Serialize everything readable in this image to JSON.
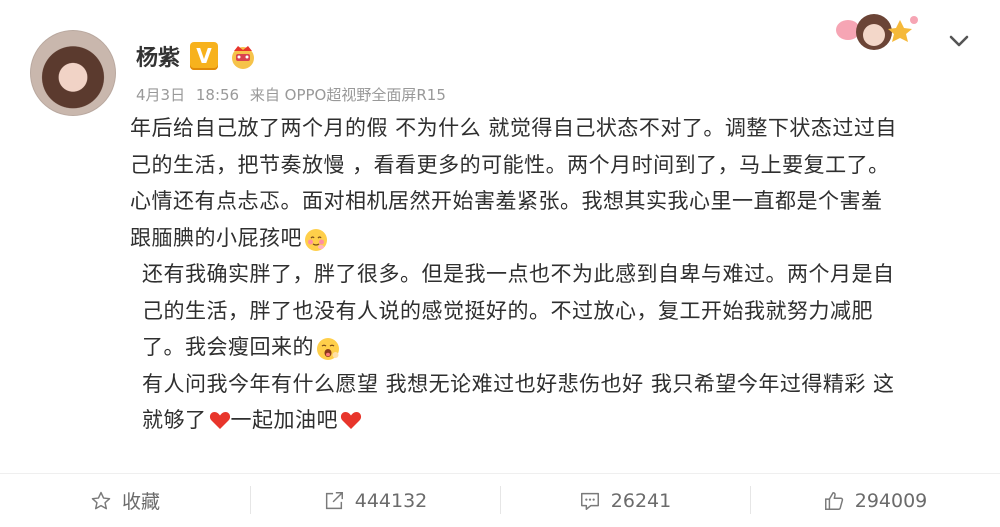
{
  "post": {
    "username": "杨紫",
    "verified_icon": "V",
    "meta": {
      "date": "4月3日",
      "time": "18:56",
      "source": "来自 OPPO超视野全面屏R15"
    },
    "paragraphs": [
      {
        "lines": [
          "年后给自己放了两个月的假 不为什么 就觉得自己状态不对了。调整下状态过过自",
          "己的生活，把节奏放慢 ，看看更多的可能性。两个月时间到了，马上要复工了。",
          "心情还有点忐忑。面对相机居然开始害羞紧张。我想其实我心里一直都是个害羞",
          "跟腼腆的小屁孩吧"
        ],
        "end_emoji": "blush-face-emoji"
      },
      {
        "lines": [
          "还有我确实胖了，胖了很多。但是我一点也不为此感到自卑与难过。两个月是自",
          "己的生活，胖了也没有人说的感觉挺好的。不过放心，复工开始我就努力减肥",
          "了。我会瘦回来的"
        ],
        "end_emoji": "yawning-face-emoji"
      },
      {
        "line1": "有人问我今年有什么愿望 我想无论难过也好悲伤也好 我只希望今年过得精彩 这",
        "line2_part1": "就够了",
        "line2_part2": "一起加油吧",
        "heart_emoji": "red-heart-emoji"
      }
    ]
  },
  "header_icons": {
    "sticker": "avatar-sticker-decoration",
    "menu": "chevron-down-icon",
    "member_badge": "crown-badge-icon"
  },
  "footer": {
    "favorite": {
      "label": "收藏",
      "icon": "star-icon"
    },
    "repost": {
      "count": "444132",
      "icon": "share-icon"
    },
    "comment": {
      "count": "26241",
      "icon": "comment-icon"
    },
    "like": {
      "count": "294009",
      "icon": "thumbs-up-icon"
    }
  },
  "colors": {
    "badge_orange": "#f7b21d",
    "text": "#2f2f2f",
    "meta_gray": "#999999",
    "heart_red": "#e8352b"
  }
}
